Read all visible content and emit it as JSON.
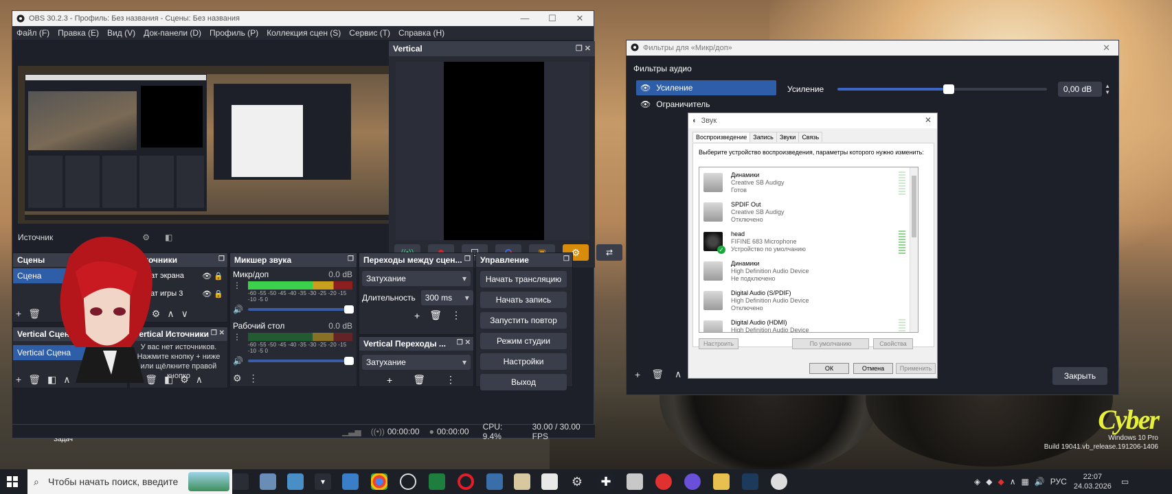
{
  "desktop": {
    "brand_logo": "Cyber",
    "brand_line1": "Windows 10 Pro",
    "brand_line2": "Build 19041.vb_release.191206-1406",
    "task_label": "Задач"
  },
  "obs": {
    "title": "OBS 30.2.3 - Профиль: Без названия - Сцены: Без названия",
    "menu": [
      "Файл (F)",
      "Правка (E)",
      "Вид (V)",
      "Док-панели (D)",
      "Профиль (P)",
      "Коллекция сцен (S)",
      "Сервис (T)",
      "Справка (H)"
    ],
    "vertical_title": "Vertical",
    "sources_bar_label": "Источник",
    "scenes": {
      "title": "Сцены",
      "items": [
        "Сцена"
      ]
    },
    "sources": {
      "title": "Источники",
      "items": [
        "Захват экрана",
        "Захват игры 3"
      ]
    },
    "mixer": {
      "title": "Микшер звука",
      "channels": [
        {
          "name": "Микр/доп",
          "db": "0.0 dB",
          "level": 0.62
        },
        {
          "name": "Рабочий стол",
          "db": "0.0 dB",
          "level": 0.0
        }
      ],
      "scale": "-60 -55 -50 -45 -40 -35 -30 -25 -20 -15 -10 -5 0"
    },
    "transitions": {
      "title": "Переходы между сцен...",
      "type": "Затухание",
      "duration_label": "Длительность",
      "duration_value": "300 ms"
    },
    "controls": {
      "title": "Управление",
      "buttons": [
        "Начать трансляцию",
        "Начать запись",
        "Запустить повтор",
        "Режим студии",
        "Настройки",
        "Выход"
      ]
    },
    "vertical_scenes": {
      "title": "Vertical Сцены",
      "items": [
        "Vertical Сцена"
      ]
    },
    "vertical_sources": {
      "title": "Vertical Источники",
      "empty_text_1": "У вас нет источников.",
      "empty_text_2": "Нажмите кнопку + ниже",
      "empty_text_3": "или щёлкните правой кнопко"
    },
    "vertical_transitions": {
      "title": "Vertical Переходы ...",
      "type": "Затухание"
    },
    "status": {
      "stream_time": "00:00:00",
      "rec_time": "00:00:00",
      "cpu": "CPU: 9.4%",
      "fps": "30.00 / 30.00 FPS"
    }
  },
  "filters": {
    "title": "Фильтры для «Микр/доп»",
    "section": "Фильтры аудио",
    "items": [
      "Усиление",
      "Ограничитель"
    ],
    "gain_label": "Усиление",
    "gain_value": "0,00 dB",
    "gain_fraction": 0.53,
    "close_label": "Закрыть"
  },
  "sound": {
    "title": "Звук",
    "tabs": [
      "Воспроизведение",
      "Запись",
      "Звуки",
      "Связь"
    ],
    "instruction": "Выберите устройство воспроизведения, параметры которого нужно изменить:",
    "devices": [
      {
        "name": "Динамики",
        "driver": "Creative SB Audigy",
        "status": "Готов"
      },
      {
        "name": "SPDIF Out",
        "driver": "Creative SB Audigy",
        "status": "Отключено"
      },
      {
        "name": "head",
        "driver": "FIFINE 683 Microphone",
        "status": "Устройство по умолчанию"
      },
      {
        "name": "Динамики",
        "driver": "High Definition Audio Device",
        "status": "Не подключено"
      },
      {
        "name": "Digital Audio (S/PDIF)",
        "driver": "High Definition Audio Device",
        "status": "Отключено"
      },
      {
        "name": "Digital Audio (HDMI)",
        "driver": "High Definition Audio Device",
        "status": ""
      }
    ],
    "btn_configure": "Настроить",
    "btn_default": "По умолчанию",
    "btn_properties": "Свойства",
    "btn_ok": "ОК",
    "btn_cancel": "Отмена",
    "btn_apply": "Применить"
  },
  "taskbar": {
    "search_placeholder": "Чтобы начать поиск, введите",
    "lang": "РУС",
    "time": "22:07",
    "date": "24.03.2026"
  },
  "colors": {
    "obs_bg": "#1e2029",
    "accent": "#2f5ea8",
    "settings_active": "#d98c0a"
  }
}
